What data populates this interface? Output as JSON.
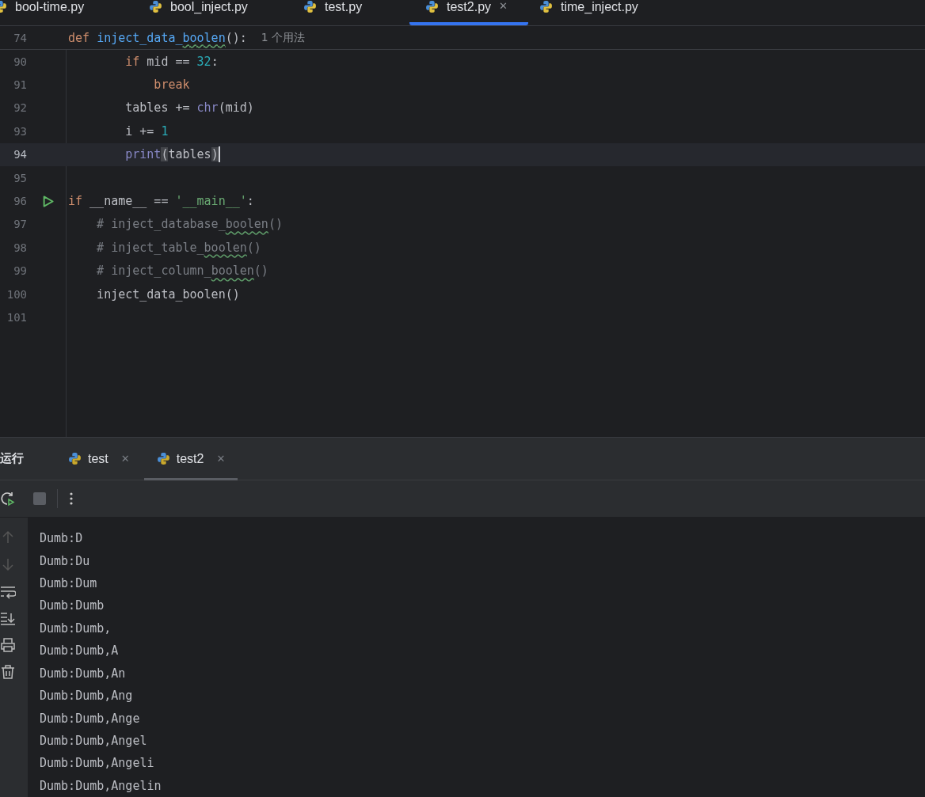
{
  "editor_tabs": [
    {
      "label": "bool-time.py",
      "selected": false
    },
    {
      "label": "bool_inject.py",
      "selected": false
    },
    {
      "label": "test.py",
      "selected": false
    },
    {
      "label": "test2.py",
      "selected": true,
      "close": "✕"
    },
    {
      "label": "time_inject.py",
      "selected": false
    }
  ],
  "sticky_header": {
    "line_number": "74",
    "tokens": [
      {
        "kind": "kw",
        "text": "def "
      },
      {
        "kind": "fn",
        "text": "inject_data_"
      },
      {
        "kind": "fn_typo",
        "text": "boolen"
      },
      {
        "kind": "plain",
        "text": "():"
      }
    ],
    "usages": "1 个用法"
  },
  "code_lines": [
    {
      "number": "90",
      "current": false,
      "tokens": [
        {
          "kind": "kw",
          "text": "        if "
        },
        {
          "kind": "plain",
          "text": "mid == "
        },
        {
          "kind": "num",
          "text": "32"
        },
        {
          "kind": "plain",
          "text": ":"
        }
      ]
    },
    {
      "number": "91",
      "current": false,
      "tokens": [
        {
          "kind": "kw",
          "text": "            break"
        }
      ]
    },
    {
      "number": "92",
      "current": false,
      "tokens": [
        {
          "kind": "plain",
          "text": "        tables += "
        },
        {
          "kind": "builtin",
          "text": "chr"
        },
        {
          "kind": "plain",
          "text": "(mid)"
        }
      ]
    },
    {
      "number": "93",
      "current": false,
      "tokens": [
        {
          "kind": "plain",
          "text": "        i += "
        },
        {
          "kind": "num",
          "text": "1"
        }
      ]
    },
    {
      "number": "94",
      "current": true,
      "caret": true,
      "tokens": [
        {
          "kind": "builtin",
          "text": "        print"
        },
        {
          "kind": "paren",
          "text": "("
        },
        {
          "kind": "plain",
          "text": "tables"
        },
        {
          "kind": "paren",
          "text": ")"
        }
      ]
    },
    {
      "number": "95",
      "current": false
    },
    {
      "number": "96",
      "current": false,
      "run": true,
      "tokens": [
        {
          "kind": "kw",
          "text": "if "
        },
        {
          "kind": "plain",
          "text": "__name__ == "
        },
        {
          "kind": "str",
          "text": "'__main__'"
        },
        {
          "kind": "plain",
          "text": ":"
        }
      ]
    },
    {
      "number": "97",
      "current": false,
      "tokens": [
        {
          "kind": "comment",
          "text": "    # inject_database_"
        },
        {
          "kind": "comment_typo",
          "text": "boolen"
        },
        {
          "kind": "comment",
          "text": "()"
        }
      ]
    },
    {
      "number": "98",
      "current": false,
      "tokens": [
        {
          "kind": "comment",
          "text": "    # inject_table_"
        },
        {
          "kind": "comment_typo",
          "text": "boolen"
        },
        {
          "kind": "comment",
          "text": "()"
        }
      ]
    },
    {
      "number": "99",
      "current": false,
      "tokens": [
        {
          "kind": "comment",
          "text": "    # inject_column_"
        },
        {
          "kind": "comment_typo",
          "text": "boolen"
        },
        {
          "kind": "comment",
          "text": "()"
        }
      ]
    },
    {
      "number": "100",
      "current": false,
      "tokens": [
        {
          "kind": "plain",
          "text": "    inject_data_boolen()"
        }
      ]
    },
    {
      "number": "101",
      "current": false
    }
  ],
  "run_panel": {
    "title": "运行",
    "tabs": [
      {
        "label": "test",
        "selected": false,
        "close": "✕"
      },
      {
        "label": "test2",
        "selected": true,
        "close": "✕"
      }
    ],
    "output": [
      "Dumb:D",
      "Dumb:Du",
      "Dumb:Dum",
      "Dumb:Dumb",
      "Dumb:Dumb,",
      "Dumb:Dumb,A",
      "Dumb:Dumb,An",
      "Dumb:Dumb,Ang",
      "Dumb:Dumb,Ange",
      "Dumb:Dumb,Angel",
      "Dumb:Dumb,Angeli",
      "Dumb:Dumb,Angelin"
    ]
  }
}
